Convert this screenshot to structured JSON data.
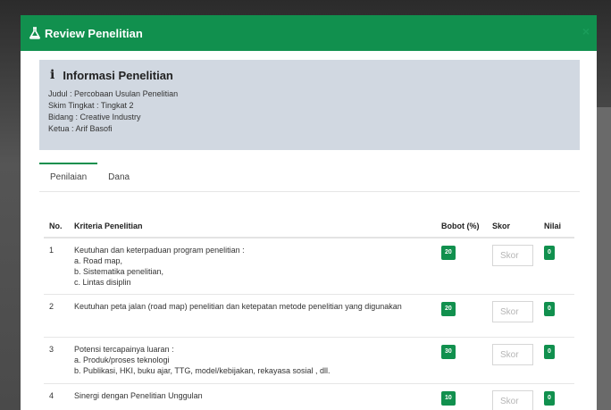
{
  "modal": {
    "title": "Review Penelitian",
    "close": "×"
  },
  "info": {
    "title": "Informasi Penelitian",
    "lines": [
      "Judul : Percobaan Usulan Penelitian",
      "Skim Tingkat : Tingkat 2",
      "Bidang : Creative Industry",
      "Ketua : Arif Basofi"
    ]
  },
  "tabs": [
    "Penilaian",
    "Dana"
  ],
  "table": {
    "headers": [
      "No.",
      "Kriteria Penelitian",
      "Bobot (%)",
      "Skor",
      "Nilai"
    ],
    "rows": [
      {
        "no": "1",
        "kriteria": [
          "Keutuhan dan keterpaduan program penelitian :",
          "a. Road map,",
          "b. Sistematika penelitian,",
          "c. Lintas disiplin"
        ],
        "bobot": "20",
        "skor_placeholder": "Skor",
        "nilai": "0"
      },
      {
        "no": "2",
        "kriteria": [
          "Keutuhan peta jalan (road map) penelitian dan ketepatan metode penelitian yang digunakan"
        ],
        "bobot": "20",
        "skor_placeholder": "Skor",
        "nilai": "0"
      },
      {
        "no": "3",
        "kriteria": [
          "Potensi tercapainya luaran :",
          "a. Produk/proses teknologi",
          "b. Publikasi, HKI, buku ajar, TTG, model/kebijakan, rekayasa sosial , dll."
        ],
        "bobot": "30",
        "skor_placeholder": "Skor",
        "nilai": "0"
      },
      {
        "no": "4",
        "kriteria": [
          "Sinergi dengan Penelitian Unggulan"
        ],
        "bobot": "10",
        "skor_placeholder": "Skor",
        "nilai": "0"
      }
    ]
  },
  "colors": {
    "header": "#11904e",
    "badge": "#11904e",
    "info_bg": "#d1d8e1"
  },
  "icons": {
    "title_icon": "flask-icon",
    "info_icon": "info-icon"
  }
}
